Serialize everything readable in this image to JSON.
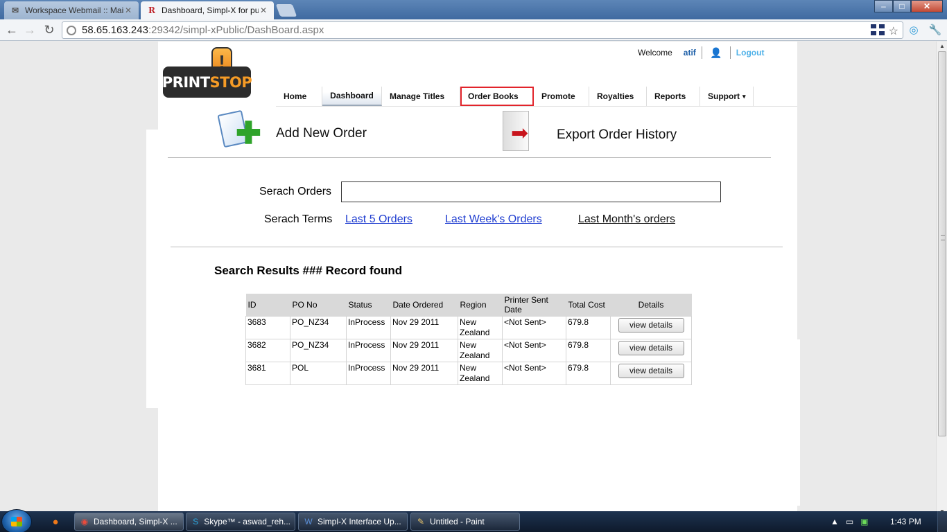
{
  "browser": {
    "tabs": [
      {
        "title": "Workspace Webmail :: Mail",
        "favicon": "envelope-favicon",
        "active": false
      },
      {
        "title": "Dashboard, Simpl-X for pub",
        "favicon": "R",
        "active": true
      }
    ],
    "url_host": "58.65.163.243",
    "url_rest": ":29342/simpl-xPublic/DashBoard.aspx",
    "close_glyph": "✕",
    "window_controls": {
      "minimize": "–",
      "maximize": "□",
      "close": "✕"
    }
  },
  "header": {
    "logo_word_white": "PRINT",
    "logo_word_orange": "STOP",
    "logo_bang": "!",
    "welcome_label": "Welcome",
    "username": "atif",
    "logout_label": "Logout"
  },
  "nav": {
    "items": [
      {
        "label": "Home"
      },
      {
        "label": "Dashboard"
      },
      {
        "label": "Manage Titles"
      },
      {
        "label": "Order Books"
      },
      {
        "label": "Promote"
      },
      {
        "label": "Royalties"
      },
      {
        "label": "Reports"
      },
      {
        "label": "Support"
      }
    ],
    "selected": "Order Books"
  },
  "actions": {
    "add_new_order": "Add New Order",
    "export_history": "Export Order History"
  },
  "search": {
    "label": "Serach Orders",
    "value": "",
    "terms_label": "Serach Terms",
    "links": [
      "Last 5 Orders",
      "Last Week's Orders",
      "Last Month's orders"
    ]
  },
  "results": {
    "title": "Search Results ### Record found",
    "columns": [
      "ID",
      "PO No",
      "Status",
      "Date Ordered",
      "Region",
      "Printer Sent Date",
      "Total Cost",
      "Details"
    ],
    "rows": [
      {
        "id": "3683",
        "po": "PO_NZ34",
        "status": "InProcess",
        "date": "Nov 29 2011",
        "region": "New Zealand",
        "printer": "<Not Sent>",
        "cost": "679.8",
        "details": "view details"
      },
      {
        "id": "3682",
        "po": "PO_NZ34",
        "status": "InProcess",
        "date": "Nov 29 2011",
        "region": "New Zealand",
        "printer": "<Not Sent>",
        "cost": "679.8",
        "details": "view details"
      },
      {
        "id": "3681",
        "po": "POL",
        "status": "InProcess",
        "date": "Nov 29 2011",
        "region": "New Zealand",
        "printer": "<Not Sent>",
        "cost": "679.8",
        "details": "view details"
      }
    ]
  },
  "taskbar": {
    "buttons": [
      {
        "label": "Dashboard, Simpl-X ...",
        "icon": "chrome-icon"
      },
      {
        "label": "Skype™ - aswad_reh...",
        "icon": "skype-icon"
      },
      {
        "label": "Simpl-X Interface Up...",
        "icon": "word-icon"
      },
      {
        "label": "Untitled - Paint",
        "icon": "paint-icon"
      }
    ],
    "clock": "1:43 PM"
  },
  "colors": {
    "accent_link": "#1e3cd0",
    "logout": "#4fb1e8",
    "selected_outline": "#e2242b",
    "logo_orange": "#f59b26"
  }
}
